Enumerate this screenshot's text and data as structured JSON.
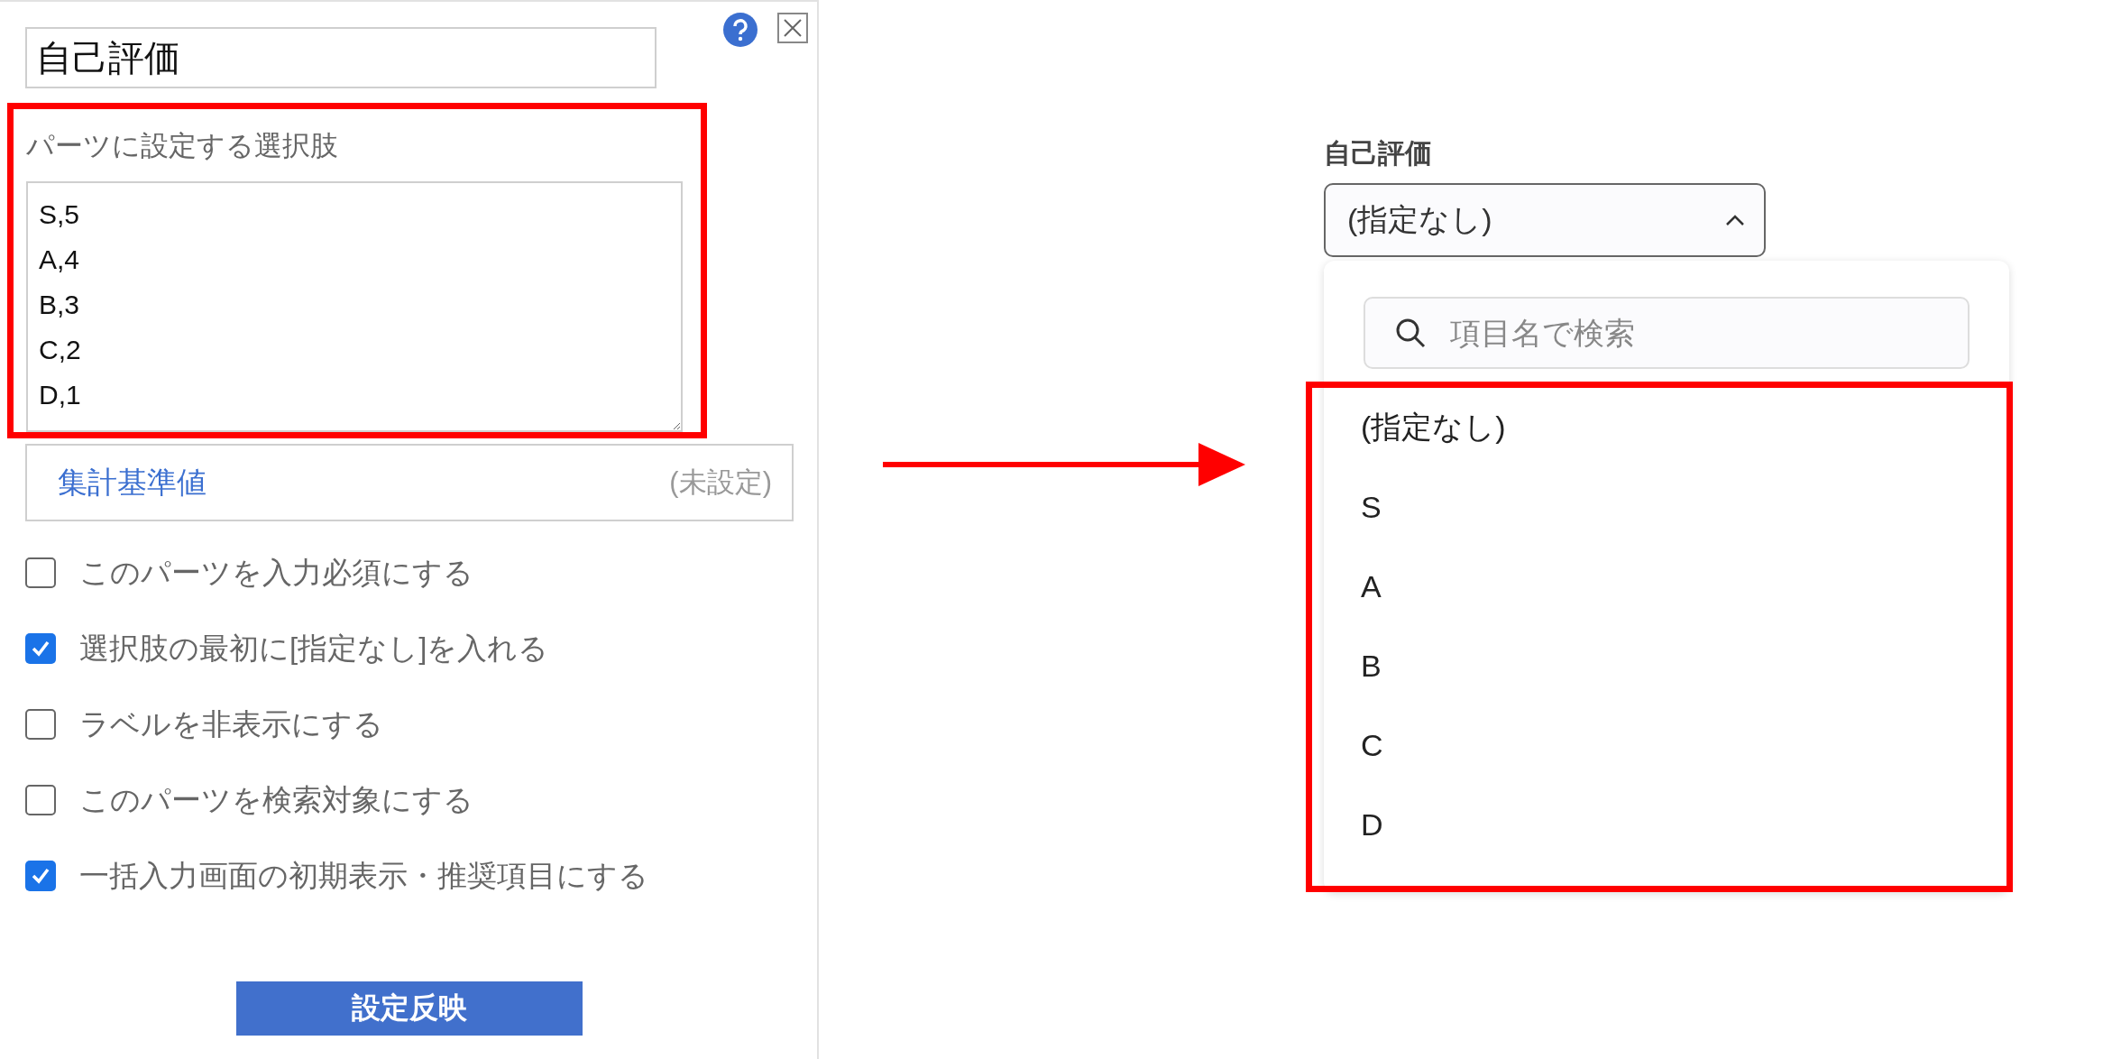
{
  "settings_panel": {
    "title_value": "自己評価",
    "choices_label": "パーツに設定する選択肢",
    "choices_value": "S,5\nA,4\nB,3\nC,2\nD,1",
    "aggregate": {
      "label": "集計基準値",
      "value": "(未設定)"
    },
    "options": [
      {
        "label": "このパーツを入力必須にする",
        "checked": false
      },
      {
        "label": "選択肢の最初に[指定なし]を入れる",
        "checked": true
      },
      {
        "label": "ラベルを非表示にする",
        "checked": false
      },
      {
        "label": "このパーツを検索対象にする",
        "checked": false
      },
      {
        "label": "一括入力画面の初期表示・推奨項目にする",
        "checked": true
      }
    ],
    "apply_button": "設定反映"
  },
  "preview": {
    "label": "自己評価",
    "select_value": "(指定なし)",
    "expanded": true,
    "search_placeholder": "項目名で検索",
    "items": [
      "(指定なし)",
      "S",
      "A",
      "B",
      "C",
      "D"
    ]
  }
}
